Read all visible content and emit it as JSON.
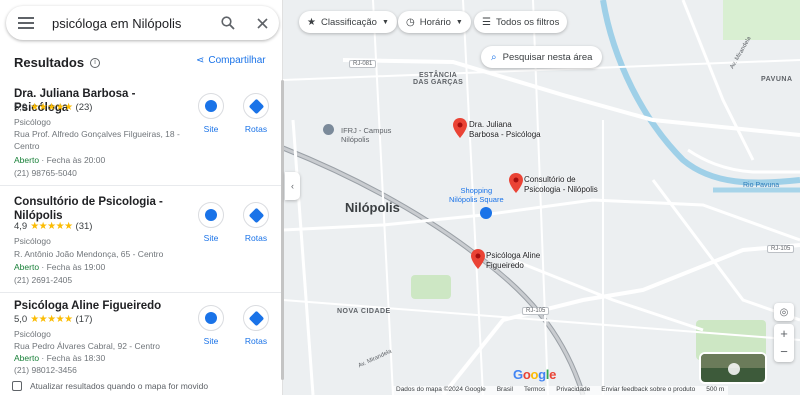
{
  "search": {
    "query": "psicóloga em Nilópolis"
  },
  "results_header": {
    "title": "Resultados",
    "share": "Compartilhar"
  },
  "places": [
    {
      "name": "Dra. Juliana Barbosa - Psicóloga",
      "rating": "5,0",
      "stars": "★★★★★",
      "reviews": "(23)",
      "category": "Psicólogo",
      "address": "Rua Prof. Alfredo Gonçalves Filgueiras, 18 - Centro",
      "status": "Aberto",
      "hours": "· Fecha às 20:00",
      "phone": "(21) 98765-5040",
      "site": "Site",
      "routes": "Rotas"
    },
    {
      "name": "Consultório de Psicologia - Nilópolis",
      "rating": "4,9",
      "stars": "★★★★★",
      "reviews": "(31)",
      "category": "Psicólogo",
      "address": "R. Antônio João Mendonça, 65 - Centro",
      "status": "Aberto",
      "hours": "· Fecha às 19:00",
      "phone": "(21) 2691-2405",
      "site": "Site",
      "routes": "Rotas"
    },
    {
      "name": "Psicóloga Aline Figueiredo",
      "rating": "5,0",
      "stars": "★★★★★",
      "reviews": "(17)",
      "category": "Psicólogo",
      "address": "Rua Pedro Álvares Cabral, 92 - Centro",
      "status": "Aberto",
      "hours": "· Fecha às 18:30",
      "phone": "(21) 98012-3456",
      "site": "Site",
      "routes": "Rotas"
    }
  ],
  "update_checkbox": "Atualizar resultados quando o mapa for movido",
  "filters": {
    "classification": "Classificação",
    "hours": "Horário",
    "all_filters": "Todos os filtros"
  },
  "search_area": "Pesquisar nesta área",
  "map": {
    "city": "Nilópolis",
    "labels": {
      "estancia": "ESTÂNCIA\nDAS GARÇAS",
      "pavuna": "PAVUNA",
      "nova_cidade": "NOVA CIDADE",
      "ifrj": "IFRJ - Campus\nNilópolis",
      "shopping": "Shopping\nNilópolis Square",
      "rio_pavuna": "Rio Pavuna",
      "av_mirandela_top": "Av. Mirandela",
      "av_mirandela_bottom": "Av. Mirandela",
      "rj081": "RJ-081",
      "rj105a": "RJ-105",
      "rj105b": "RJ-105"
    },
    "pins": [
      {
        "label": "Dra. Juliana\nBarbosa - Psicóloga"
      },
      {
        "label": "Consultório de\nPsicologia - Nilópolis"
      },
      {
        "label": "Psicóloga Aline\nFigueiredo"
      }
    ]
  },
  "footer": [
    "Dados do mapa ©2024 Google",
    "Brasil",
    "Termos",
    "Privacidade",
    "Enviar feedback sobre o produto",
    "500 m"
  ],
  "brand": "Google",
  "colors": {
    "accent": "#1a73e8",
    "pin": "#ea4335",
    "open": "#188038",
    "star": "#fbbc04"
  }
}
